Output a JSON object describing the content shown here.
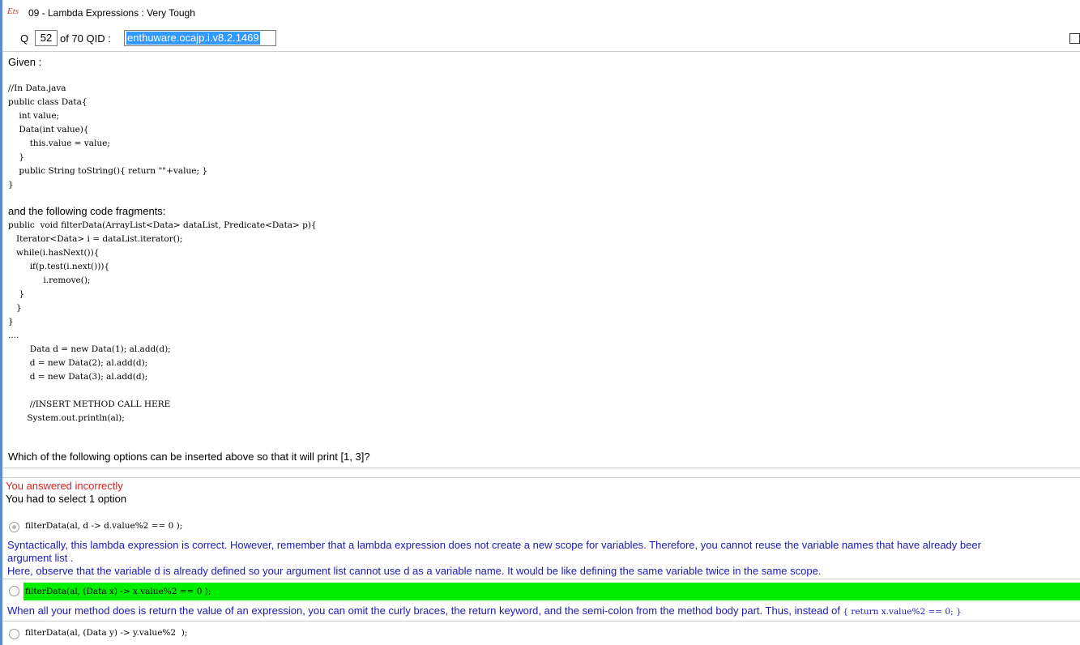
{
  "window": {
    "title": "09 - Lambda Expressions : Very Tough",
    "app_icon_text": "Ets"
  },
  "question_bar": {
    "q_label": "Q",
    "q_number": "52",
    "of_text": "of 70 QID :",
    "qid": "enthuware.ocajp.i.v8.2.1469"
  },
  "question": {
    "given_label": "Given :",
    "code_block_1": "//In Data.java\npublic class Data{\n    int value;\n    Data(int value){\n        this.value = value;\n    }\n    public String toString(){ return \"\"+value; }\n}",
    "following_label": "and the following code fragments:",
    "code_block_2": "public  void filterData(ArrayList<Data> dataList, Predicate<Data> p){\n   Iterator<Data> i = dataList.iterator();\n   while(i.hasNext()){\n        if(p.test(i.next())){\n             i.remove();\n    }\n   }\n}\n....\n        Data d = new Data(1); al.add(d);\n        d = new Data(2); al.add(d);\n        d = new Data(3); al.add(d);\n\n        //INSERT METHOD CALL HERE\n       System.out.println(al);",
    "question_text": "Which of the following options can be inserted above so that it will print [1, 3]?"
  },
  "result": {
    "status": "You answered incorrectly",
    "instruction": "You had to select 1 option"
  },
  "options": [
    {
      "code": "filterData(al, d -> d.value%2 == 0 );",
      "explanation_lines": [
        "Syntactically, this lambda expression is correct. However, remember that a lambda expression does not create a new scope for variables. Therefore, you cannot reuse the variable names that have already beer",
        "argument list .",
        "Here, observe that the variable d is already defined so your argument list cannot use d as a variable name. It would be like defining the same variable twice in the same scope."
      ]
    },
    {
      "code": "filterData(al, (Data x) -> x.value%2 == 0 );",
      "explanation_text": "When all your method does is return the value of an expression, you can omit the curly braces, the return keyword, and the semi-colon from the method body part. Thus, instead of",
      "explanation_code": " { return x.value%2 == 0; }"
    },
    {
      "code": "filterData(al, (Data y) -> y.value%2  );"
    }
  ],
  "colors": {
    "correct_highlight": "#00ee00",
    "explanation_text": "#1a1ab8",
    "incorrect_text": "#e02020",
    "selection": "#3399ff"
  }
}
